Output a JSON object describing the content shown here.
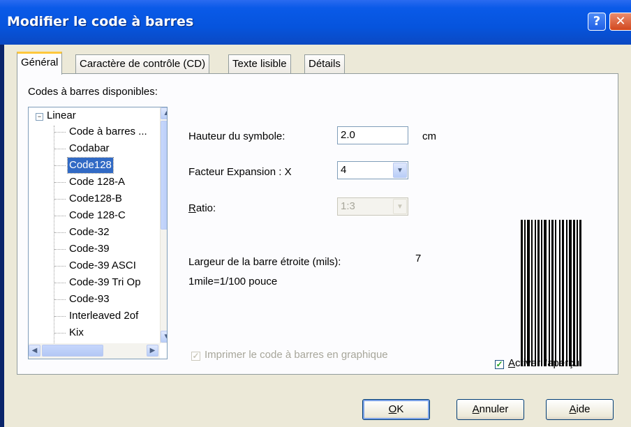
{
  "window": {
    "title": "Modifier le code à barres"
  },
  "tabs": [
    {
      "label": "Général"
    },
    {
      "label": "Caractère de contrôle (CD)"
    },
    {
      "label": "Texte lisible"
    },
    {
      "label": "Détails"
    }
  ],
  "general": {
    "available_label": "Codes à barres disponibles:",
    "tree_root": "Linear",
    "tree_items": [
      "Code à barres ...",
      "Codabar",
      "Code128",
      "Code 128-A",
      "Code128-B",
      "Code 128-C",
      "Code-32",
      "Code-39",
      "Code-39 ASCI",
      "Code-39 Tri Op",
      "Code-93",
      "Interleaved 2of",
      "Kix"
    ],
    "selected_item": "Code128",
    "height_label": "Hauteur du symbole:",
    "height_value": "2.0",
    "height_unit": "cm",
    "expansion_label": "Facteur Expansion : X",
    "expansion_value": "4",
    "ratio_label_first": "R",
    "ratio_label_rest": "atio:",
    "ratio_value": "1:3",
    "narrow_label": "Largeur de la barre étroite (mils):",
    "narrow_value": "7",
    "mil_note": "1mile=1/100 pouce",
    "print_graphic_label": "Imprimer le code à barres en graphique",
    "print_graphic_checked": true,
    "preview_label_first": "A",
    "preview_label_rest": "ctiver l'aperçu",
    "preview_checked": true
  },
  "buttons": {
    "ok_first": "O",
    "ok_rest": "K",
    "cancel_first": "A",
    "cancel_rest": "nnuler",
    "help_first": "A",
    "help_rest": "ide"
  },
  "colors": {
    "title_bar": "#0654dd",
    "selection": "#316ac5",
    "tab_highlight": "#ffc83c",
    "dialog_bg": "#ece9d8"
  },
  "icons": {
    "help": "question-mark-icon",
    "close": "close-x-icon"
  }
}
